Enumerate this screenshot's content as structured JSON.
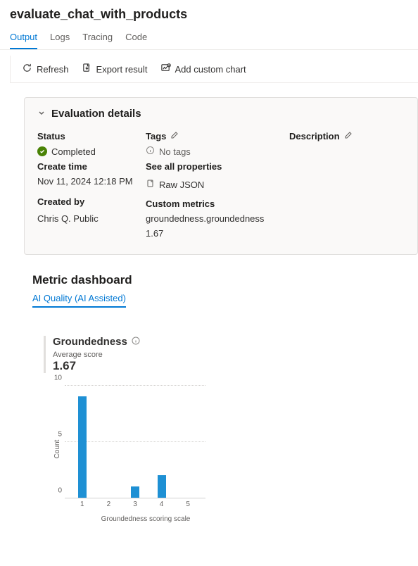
{
  "header": {
    "title": "evaluate_chat_with_products"
  },
  "tabs": {
    "output": "Output",
    "logs": "Logs",
    "tracing": "Tracing",
    "code": "Code"
  },
  "toolbar": {
    "refresh": "Refresh",
    "export": "Export result",
    "add_chart": "Add custom chart"
  },
  "details": {
    "section_title": "Evaluation details",
    "status_label": "Status",
    "status_value": "Completed",
    "create_time_label": "Create time",
    "create_time_value": "Nov 11, 2024 12:18 PM",
    "created_by_label": "Created by",
    "created_by_value": "Chris Q. Public",
    "tags_label": "Tags",
    "no_tags": "No tags",
    "see_all": "See all properties",
    "raw_json": "Raw JSON",
    "custom_metrics_label": "Custom metrics",
    "metric_name": "groundedness.groundedness",
    "metric_value": "1.67",
    "description_label": "Description"
  },
  "dashboard": {
    "title": "Metric dashboard",
    "subtab": "AI Quality (AI Assisted)"
  },
  "chart": {
    "title": "Groundedness",
    "avg_label": "Average score",
    "avg_value": "1.67"
  },
  "chart_data": {
    "type": "bar",
    "title": "Groundedness",
    "xlabel": "Groundedness scoring scale",
    "ylabel": "Count",
    "categories": [
      "1",
      "2",
      "3",
      "4",
      "5"
    ],
    "values": [
      9,
      0,
      1,
      2,
      0
    ],
    "ylim": [
      0,
      10
    ],
    "yticks": [
      0,
      5,
      10
    ]
  }
}
